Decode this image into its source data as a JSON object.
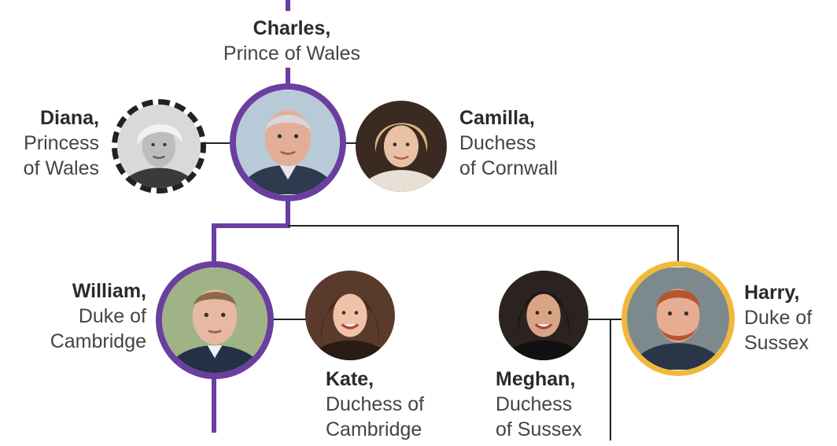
{
  "colors": {
    "lineage": "#6a3fa0",
    "connector": "#222222",
    "harry_ring": "#f0b93a",
    "diana_ring": "#222222"
  },
  "people": {
    "charles": {
      "name": "Charles,",
      "title_lines": [
        "Prince of Wales"
      ]
    },
    "diana": {
      "name": "Diana,",
      "title_lines": [
        "Princess",
        "of Wales"
      ]
    },
    "camilla": {
      "name": "Camilla,",
      "title_lines": [
        "Duchess",
        "of Cornwall"
      ]
    },
    "william": {
      "name": "William,",
      "title_lines": [
        "Duke of",
        "Cambridge"
      ]
    },
    "kate": {
      "name": "Kate,",
      "title_lines": [
        "Duchess of",
        "Cambridge"
      ]
    },
    "meghan": {
      "name": "Meghan,",
      "title_lines": [
        "Duchess",
        "of Sussex"
      ]
    },
    "harry": {
      "name": "Harry,",
      "title_lines": [
        "Duke of",
        "Sussex"
      ]
    }
  }
}
